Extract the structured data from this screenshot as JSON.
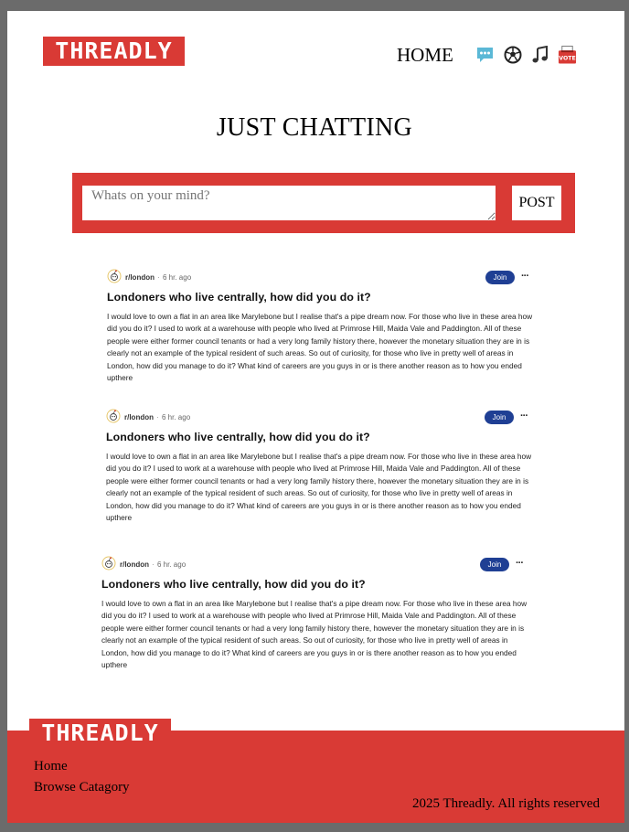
{
  "brand": {
    "logo_text": "THREADLY",
    "accent_color": "#d93a35",
    "button_color": "#1f3f94"
  },
  "nav": {
    "home_label": "HOME",
    "icons": [
      "chat-icon",
      "soccer-ball-icon",
      "music-note-icon",
      "vote-icon"
    ],
    "vote_icon_text": "VOTE"
  },
  "page_title": "JUST CHATTING",
  "composer": {
    "placeholder": "Whats on your mind?",
    "post_label": "POST"
  },
  "posts": [
    {
      "subreddit": "r/london",
      "separator": "·",
      "time": "6 hr. ago",
      "join_label": "Join",
      "more_label": "···",
      "title": "Londoners who live centrally, how did you do it?",
      "body": "I would love to own a flat in an area like Marylebone but I realise that's a pipe dream now. For those who live in these area how did you do it? I used to work at a warehouse with people who lived at Primrose Hill, Maida Vale and Paddington. All of these people were either former council tenants or had a very long family history there, however the monetary situation they are in is clearly not an example of the typical resident of such areas. So out of curiosity, for those who live in pretty well of areas in London, how did you manage to do it? What kind of careers are you guys in or is there another reason as to how you ended upthere"
    },
    {
      "subreddit": "r/london",
      "separator": "·",
      "time": "6 hr. ago",
      "join_label": "Join",
      "more_label": "···",
      "title": "Londoners who live centrally, how did you do it?",
      "body": "I would love to own a flat in an area like Marylebone but I realise that's a pipe dream now. For those who live in these area how did you do it? I used to work at a warehouse with people who lived at Primrose Hill, Maida Vale and Paddington. All of these people were either former council tenants or had a very long family history there, however the monetary situation they are in is clearly not an example of the typical resident of such areas. So out of curiosity, for those who live in pretty well of areas in London, how did you manage to do it? What kind of careers are you guys in or is there another reason as to how you ended upthere"
    },
    {
      "subreddit": "r/london",
      "separator": "·",
      "time": "6 hr. ago",
      "join_label": "Join",
      "more_label": "···",
      "title": "Londoners who live centrally, how did you do it?",
      "body": "I would love to own a flat in an area like Marylebone but I realise that's a pipe dream now. For those who live in these area how did you do it? I used to work at a warehouse with people who lived at Primrose Hill, Maida Vale and Paddington. All of these people were either former council tenants or had a very long family history there, however the monetary situation they are in is clearly not an example of the typical resident of such areas. So out of curiosity, for those who live in pretty well of areas in London, how did you manage to do it? What kind of careers are you guys in or is there another reason as to how you ended upthere"
    }
  ],
  "footer": {
    "logo_text": "THREADLY",
    "links": [
      "Home",
      "Browse Catagory"
    ],
    "copyright": "2025 Threadly. All rights reserved"
  }
}
